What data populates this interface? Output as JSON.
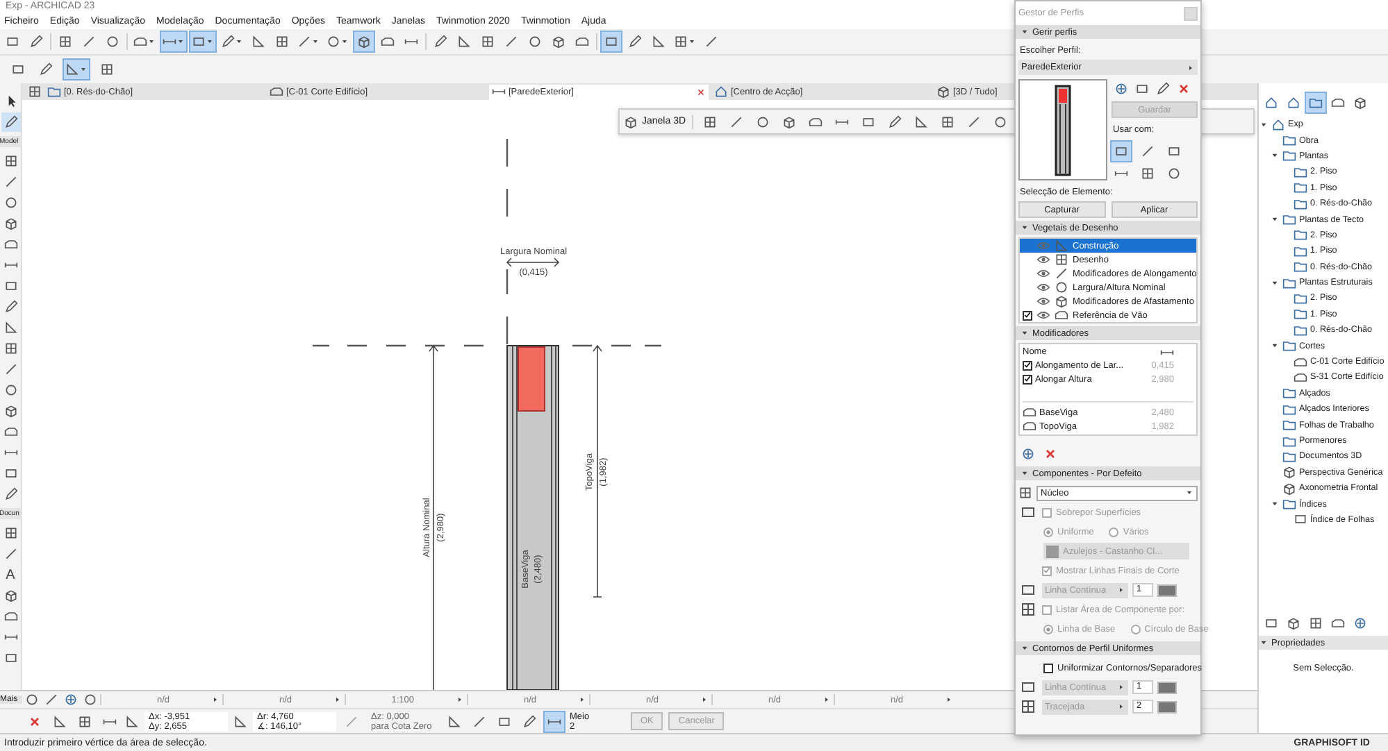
{
  "window": {
    "title": "Exp - ARCHICAD 23"
  },
  "menu": [
    "Ficheiro",
    "Edição",
    "Visualização",
    "Modelação",
    "Documentação",
    "Opções",
    "Teamwork",
    "Janelas",
    "Twinmotion 2020",
    "Twinmotion",
    "Ajuda"
  ],
  "toolbar": [
    {
      "kind": "icon",
      "selected": false
    },
    {
      "kind": "icon",
      "selected": false
    },
    {
      "kind": "sep"
    },
    {
      "kind": "icon",
      "selected": false
    },
    {
      "kind": "icon",
      "selected": false
    },
    {
      "kind": "icon",
      "selected": false
    },
    {
      "kind": "sep"
    },
    {
      "kind": "drop",
      "selected": false
    },
    {
      "kind": "drop",
      "selected": true
    },
    {
      "kind": "drop",
      "selected": true
    },
    {
      "kind": "drop",
      "selected": false
    },
    {
      "kind": "icon",
      "selected": false
    },
    {
      "kind": "icon",
      "selected": false
    },
    {
      "kind": "drop",
      "selected": false
    },
    {
      "kind": "drop",
      "selected": false
    },
    {
      "kind": "icon",
      "selected": true
    },
    {
      "kind": "icon",
      "selected": false
    },
    {
      "kind": "icon",
      "selected": false
    },
    {
      "kind": "sep"
    },
    {
      "kind": "icon",
      "selected": false
    },
    {
      "kind": "icon",
      "selected": false
    },
    {
      "kind": "icon",
      "selected": false
    },
    {
      "kind": "icon",
      "selected": false
    },
    {
      "kind": "icon",
      "selected": false
    },
    {
      "kind": "icon",
      "selected": false
    },
    {
      "kind": "icon",
      "selected": false
    },
    {
      "kind": "sep"
    },
    {
      "kind": "icon",
      "selected": true
    },
    {
      "kind": "icon",
      "selected": false
    },
    {
      "kind": "icon",
      "selected": false
    },
    {
      "kind": "drop",
      "selected": false
    },
    {
      "kind": "icon",
      "selected": false
    }
  ],
  "toolbar2": [
    {
      "kind": "icon",
      "selected": false
    },
    {
      "kind": "icon",
      "selected": false
    },
    {
      "kind": "drop",
      "selected": true
    },
    {
      "kind": "icon",
      "selected": false
    }
  ],
  "tabs": [
    {
      "label": "[0. Rés-do-Chão]",
      "selected": false,
      "kind": "plan"
    },
    {
      "label": "[C-01 Corte Edifício]",
      "selected": false,
      "kind": "section"
    },
    {
      "label": "[ParedeExterior]",
      "selected": true,
      "kind": "profile"
    },
    {
      "label": "[Centro de Acção]",
      "selected": false,
      "kind": "action"
    },
    {
      "label": "[3D / Tudo]",
      "selected": false,
      "kind": "view3d"
    }
  ],
  "toolbox": [
    {
      "kind": "tool",
      "selected": false
    },
    {
      "kind": "tool",
      "selected": true
    },
    {
      "kind": "section",
      "label": "Model"
    },
    {
      "kind": "tool",
      "selected": false
    },
    {
      "kind": "tool",
      "selected": false
    },
    {
      "kind": "tool",
      "selected": false
    },
    {
      "kind": "tool",
      "selected": false
    },
    {
      "kind": "tool",
      "selected": false
    },
    {
      "kind": "tool",
      "selected": false
    },
    {
      "kind": "tool",
      "selected": false
    },
    {
      "kind": "tool",
      "selected": false
    },
    {
      "kind": "tool",
      "selected": false
    },
    {
      "kind": "tool",
      "selected": false
    },
    {
      "kind": "tool",
      "selected": false
    },
    {
      "kind": "tool",
      "selected": false
    },
    {
      "kind": "tool",
      "selected": false
    },
    {
      "kind": "tool",
      "selected": false
    },
    {
      "kind": "tool",
      "selected": false
    },
    {
      "kind": "tool",
      "selected": false
    },
    {
      "kind": "tool",
      "selected": false
    },
    {
      "kind": "section",
      "label": "Docun"
    },
    {
      "kind": "tool",
      "selected": false
    },
    {
      "kind": "tool",
      "selected": false
    },
    {
      "kind": "text",
      "label": "A"
    },
    {
      "kind": "tool",
      "selected": false
    },
    {
      "kind": "tool",
      "selected": false
    },
    {
      "kind": "tool",
      "selected": false
    },
    {
      "kind": "tool",
      "selected": false
    }
  ],
  "canvas": {
    "width_label": "Largura Nominal",
    "width_value": "(0,415)",
    "height_label": "Altura Nominal",
    "height_value": "(2,980)",
    "top_label": "TopoViga",
    "top_value": "(1,982)",
    "base_label": "BaseViga",
    "base_value": "(2,480)"
  },
  "view_toolbar": {
    "label": "Janela 3D"
  },
  "profile_manager": {
    "title": "Gestor de Perfis",
    "manage": {
      "header": "Gerir perfis",
      "expanded": true,
      "choose_label": "Escolher Perfil:",
      "profile": "ParedeExterior",
      "save_button": {
        "label": "Guardar",
        "disabled": true
      },
      "use_with_label": "Usar com:",
      "use_with": [
        {
          "selected": true
        },
        {
          "selected": false
        },
        {
          "selected": false
        },
        {
          "selected": false
        },
        {
          "selected": false
        },
        {
          "selected": false
        }
      ],
      "selection_label": "Selecção de Elemento:",
      "buttons": [
        "Capturar",
        "Aplicar"
      ]
    },
    "layers": {
      "header": "Vegetais de Desenho",
      "expanded": true,
      "items": [
        {
          "kind": "layer",
          "label": "Construção",
          "selected": true
        },
        {
          "kind": "layer",
          "label": "Desenho",
          "selected": false
        },
        {
          "kind": "layer",
          "label": "Modificadores de Alongamento",
          "selected": false
        },
        {
          "kind": "layer",
          "label": "Largura/Altura Nominal",
          "selected": false
        },
        {
          "kind": "layer",
          "label": "Modificadores de Afastamento",
          "selected": false
        },
        {
          "kind": "check",
          "label": "Referência de Vão",
          "selected": false,
          "checked": true
        }
      ]
    },
    "modifiers": {
      "header": "Modificadores",
      "expanded": true,
      "column": "Nome",
      "rows": [
        {
          "kind": "check",
          "label": "Alongamento de Lar...",
          "value": "0,415",
          "checked": true
        },
        {
          "kind": "check",
          "label": "Alongar Altura",
          "value": "2,980",
          "checked": true
        },
        {
          "kind": "gap"
        },
        {
          "kind": "param",
          "label": "BaseViga",
          "value": "2,480"
        },
        {
          "kind": "param",
          "label": "TopoViga",
          "value": "1,982"
        }
      ]
    },
    "components": {
      "header": "Componentes - Por Defeito",
      "expanded": true,
      "component": "Núcleo",
      "override": {
        "label": "Sobrepor Superfícies",
        "checked": false,
        "disabled": true
      },
      "override_radios": [
        {
          "label": "Uniforme",
          "selected": true
        },
        {
          "label": "Vários",
          "selected": false
        }
      ],
      "material": "Azulejos - Castanho Cl...",
      "end_lines": {
        "label": "Mostrar Linhas Finais de Corte",
        "checked": true,
        "disabled": true
      },
      "line_type": "Linha Contínua",
      "pen": "1",
      "list_area": {
        "label": "Listar Área de Componente por:",
        "checked": false,
        "disabled": true
      },
      "area_radios": [
        {
          "label": "Linha de Base",
          "selected": true
        },
        {
          "label": "Círculo de Base",
          "selected": false
        }
      ]
    },
    "contours": {
      "header": "Contornos de Perfil Uniformes",
      "expanded": true,
      "uniform": {
        "label": "Uniformizar Contornos/Separadores",
        "checked": false
      },
      "rows": [
        {
          "line": "Linha Contínua",
          "pen": "1"
        },
        {
          "line": "Tracejada",
          "pen": "2"
        }
      ]
    }
  },
  "navigator": {
    "tree": [
      {
        "label": "Exp",
        "kind": "project",
        "expanded": true,
        "children": [
          {
            "label": "Obra",
            "kind": "folder"
          },
          {
            "label": "Plantas",
            "kind": "folder",
            "expanded": true,
            "children": [
              {
                "label": "2. Piso",
                "kind": "folder"
              },
              {
                "label": "1. Piso",
                "kind": "folder"
              },
              {
                "label": "0. Rés-do-Chão",
                "kind": "folder"
              }
            ]
          },
          {
            "label": "Plantas de Tecto",
            "kind": "folder",
            "expanded": true,
            "children": [
              {
                "label": "2. Piso",
                "kind": "folder"
              },
              {
                "label": "1. Piso",
                "kind": "folder"
              },
              {
                "label": "0. Rés-do-Chão",
                "kind": "folder"
              }
            ]
          },
          {
            "label": "Plantas Estruturais",
            "kind": "folder",
            "expanded": true,
            "children": [
              {
                "label": "2. Piso",
                "kind": "folder"
              },
              {
                "label": "1. Piso",
                "kind": "folder"
              },
              {
                "label": "0. Rés-do-Chão",
                "kind": "folder"
              }
            ]
          },
          {
            "label": "Cortes",
            "kind": "folder",
            "expanded": true,
            "children": [
              {
                "label": "C-01 Corte Edifício",
                "kind": "section"
              },
              {
                "label": "S-31 Corte Edifício",
                "kind": "section"
              }
            ]
          },
          {
            "label": "Alçados",
            "kind": "folder"
          },
          {
            "label": "Alçados Interiores",
            "kind": "folder"
          },
          {
            "label": "Folhas de Trabalho",
            "kind": "folder"
          },
          {
            "label": "Pormenores",
            "kind": "folder"
          },
          {
            "label": "Documentos 3D",
            "kind": "folder"
          },
          {
            "label": "Perspectiva Genérica",
            "kind": "view"
          },
          {
            "label": "Axonometria Frontal",
            "kind": "view"
          },
          {
            "label": "Índices",
            "kind": "folder",
            "expanded": true,
            "children": [
              {
                "label": "Índice de Folhas",
                "kind": "sheet"
              }
            ]
          }
        ]
      }
    ],
    "properties": {
      "header": "Propriedades",
      "expanded": true,
      "text": "Sem Selecção."
    }
  },
  "info_row": {
    "more": "Mais",
    "fields": [
      "n/d",
      "n/d",
      "1:100",
      "n/d",
      "n/d",
      "n/d",
      "n/d"
    ]
  },
  "coords": {
    "dx": "Δx: -3,951",
    "dy": "Δy: 2,655",
    "dr": "Δr: 4,760",
    "angle": "∡: 146,10°",
    "dz": "Δz: 0,000",
    "dz_ref": "para Cota Zero",
    "snap": "Meio",
    "snap_value": "2",
    "buttons": [
      {
        "label": "OK",
        "disabled": true
      },
      {
        "label": "Cancelar",
        "disabled": true
      }
    ]
  },
  "status_bar": {
    "text": "Introduzir primeiro vértice da área de selecção.",
    "brand": "GRAPHISOFT ID"
  }
}
